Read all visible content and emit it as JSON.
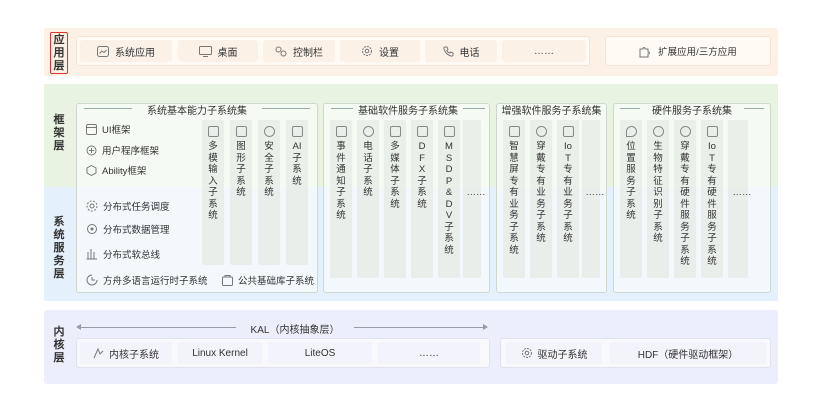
{
  "layers": {
    "app": "应用层",
    "framework": "框架层",
    "system_services": "系统服务层",
    "kernel": "内核层"
  },
  "app_layer": {
    "items": [
      {
        "label": "系统应用",
        "icon": "app-window-icon"
      },
      {
        "label": "桌面",
        "icon": "monitor-icon"
      },
      {
        "label": "控制栏",
        "icon": "toggle-switch-icon"
      },
      {
        "label": "设置",
        "icon": "gear-icon"
      },
      {
        "label": "电话",
        "icon": "phone-icon"
      },
      {
        "label": "……",
        "icon": ""
      }
    ],
    "extension": {
      "label": "扩展应用/三方应用",
      "icon": "puzzle-icon"
    }
  },
  "basic_capability": {
    "title": "系统基本能力子系统集",
    "framework_items": [
      "UI框架",
      "用户程序框架",
      "Ability框架"
    ],
    "service_items": [
      "分布式任务调度",
      "分布式数据管理",
      "分布式软总线"
    ],
    "bottom_items": [
      "方舟多语言运行时子系统",
      "公共基础库子系统"
    ],
    "columns": [
      "多模输入子系统",
      "图形子系统",
      "安全子系统",
      "AI子系统"
    ]
  },
  "basic_software": {
    "title": "基础软件服务子系统集",
    "columns": [
      "事件通知子系统",
      "电话子系统",
      "多媒体子系统",
      "DFX子系统",
      "MSDP&DV子系统",
      "……"
    ]
  },
  "enhanced_software": {
    "title": "增强软件服务子系统集",
    "columns": [
      "智慧屏专有业务子系统",
      "穿戴专有业务子系统",
      "IoT专有业务子系统",
      "……"
    ]
  },
  "hardware_service": {
    "title": "硬件服务子系统集",
    "columns": [
      "位置服务子系统",
      "生物特征识别子系统",
      "穿戴专有硬件服务子系统",
      "IoT专有硬件服务子系统",
      "……"
    ]
  },
  "kernel_layer": {
    "kal": "KAL（内核抽象层）",
    "kernel_subsystem": "内核子系统",
    "kernels": [
      "Linux Kernel",
      "LiteOS",
      "……"
    ],
    "driver_subsystem": "驱动子系统",
    "hdf": "HDF（硬件驱动框架）"
  }
}
